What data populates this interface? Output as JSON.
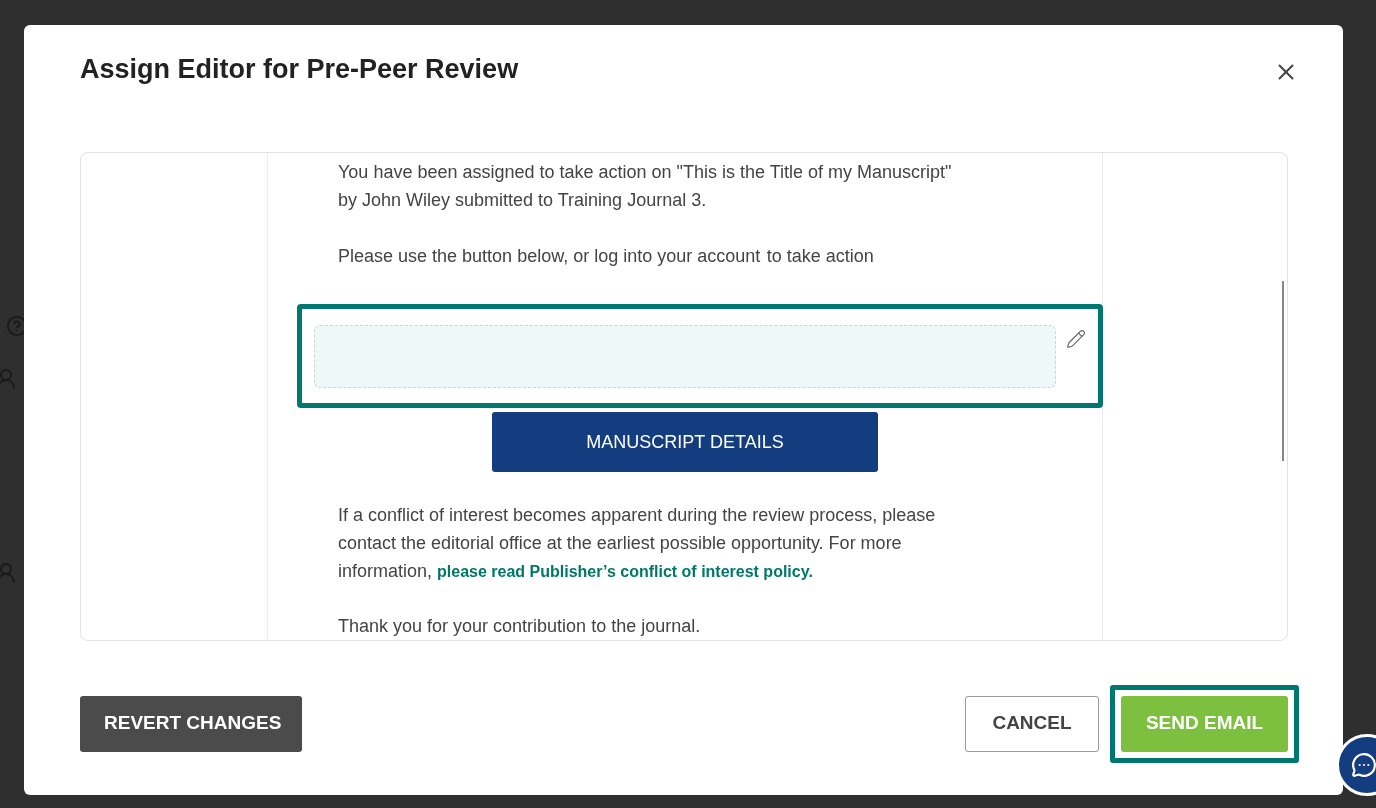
{
  "background": {
    "left_fragments": [
      {
        "kind": "help"
      },
      {
        "kind": "person"
      },
      {
        "kind": "person"
      }
    ]
  },
  "dialog": {
    "title": "Assign Editor for Pre-Peer Review",
    "email": {
      "intro": "You have been assigned to take action on \"This is the Title of my Manuscript\" by John Wiley submitted to Training Journal 3.",
      "instruction": "Please use the button below, or log into your account  to take action",
      "highlighted_block": true,
      "action_button": "MANUSCRIPT DETAILS",
      "conflict_text": "If a conflict of interest becomes apparent during the review process, please contact the editorial office at the earliest possible opportunity. For more information, ",
      "conflict_link": "please read Publisher’s conflict of interest policy.",
      "closing": "Thank you for your contribution to the journal."
    },
    "buttons": [
      {
        "kind": "revert",
        "label": "REVERT CHANGES",
        "highlighted": false
      },
      {
        "kind": "cancel",
        "label": "CANCEL",
        "highlighted": false
      },
      {
        "kind": "send",
        "label": "SEND EMAIL",
        "highlighted": true
      }
    ]
  }
}
